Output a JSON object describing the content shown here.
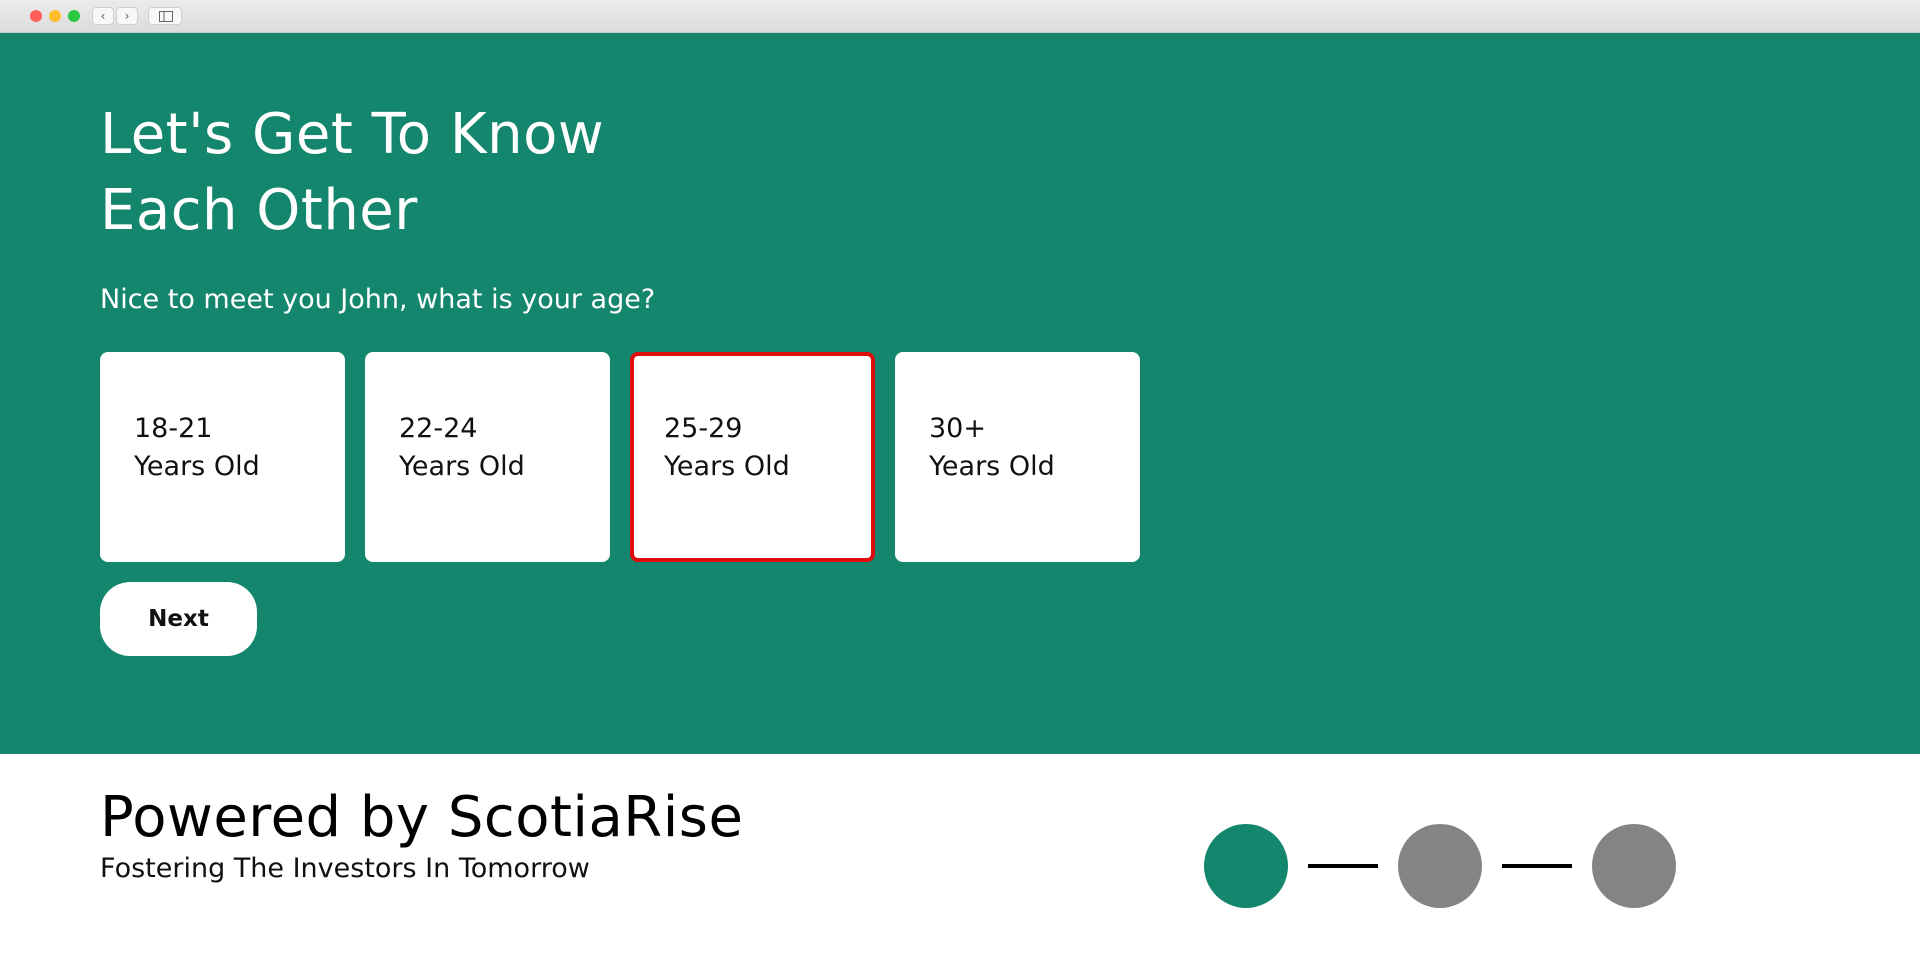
{
  "browser": {
    "back_glyph": "‹",
    "forward_glyph": "›"
  },
  "hero": {
    "title_line1": "Let's Get To Know",
    "title_line2": "Each Other",
    "question": "Nice to meet you John, what is your age?",
    "options": [
      {
        "range": "18-21",
        "unit": "Years Old",
        "selected": false
      },
      {
        "range": "22-24",
        "unit": "Years Old",
        "selected": false
      },
      {
        "range": "25-29",
        "unit": "Years Old",
        "selected": true
      },
      {
        "range": "30+",
        "unit": "Years Old",
        "selected": false
      }
    ],
    "next_label": "Next"
  },
  "footer": {
    "brand": "Powered by ScotiaRise",
    "tagline": "Fostering The Investors In Tomorrow",
    "steps": {
      "total": 3,
      "current": 1
    }
  },
  "colors": {
    "primary_green": "#14866d",
    "selected_border": "#e00b0b",
    "inactive_step": "#848484"
  }
}
